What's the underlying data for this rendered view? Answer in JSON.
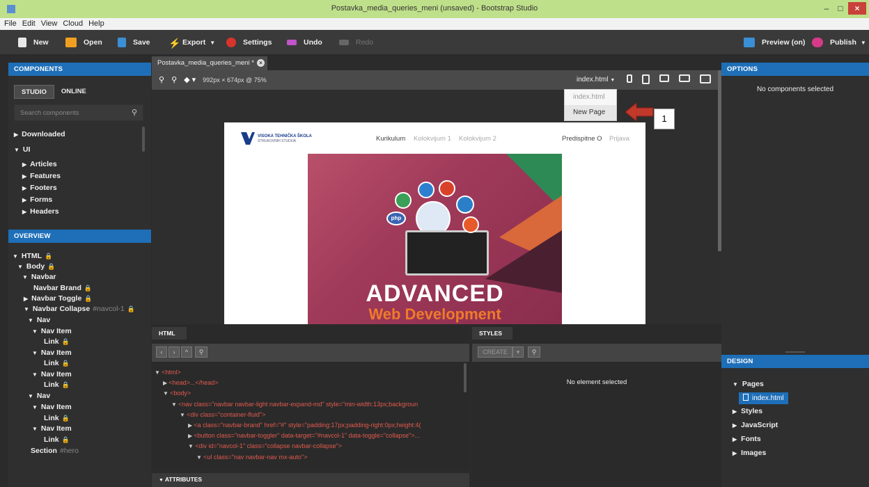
{
  "window": {
    "title": "Postavka_media_queries_meni (unsaved) - Bootstrap Studio",
    "min": "–",
    "max": "□",
    "close": "×"
  },
  "menu": [
    "File",
    "Edit",
    "View",
    "Cloud",
    "Help"
  ],
  "toolbar": {
    "new": "New",
    "open": "Open",
    "save": "Save",
    "export": "Export",
    "settings": "Settings",
    "undo": "Undo",
    "redo": "Redo",
    "preview": "Preview (on)",
    "publish": "Publish"
  },
  "colors": {
    "accent": "#1e6fb8",
    "code_tag": "#e05a4e",
    "callout_arrow": "#c0392b"
  },
  "components": {
    "header": "COMPONENTS",
    "tabs": [
      "STUDIO",
      "ONLINE"
    ],
    "search_placeholder": "Search components",
    "items": [
      {
        "label": "Downloaded",
        "expanded": false
      },
      {
        "label": "UI",
        "expanded": true
      },
      {
        "label": "Articles",
        "expanded": false
      },
      {
        "label": "Features",
        "expanded": false
      },
      {
        "label": "Footers",
        "expanded": false
      },
      {
        "label": "Forms",
        "expanded": false
      },
      {
        "label": "Headers",
        "expanded": false
      }
    ]
  },
  "overview": {
    "header": "OVERVIEW",
    "items": [
      {
        "label": "HTML"
      },
      {
        "label": "Body"
      },
      {
        "label": "Navbar"
      },
      {
        "label": "Navbar Brand"
      },
      {
        "label": "Navbar Toggle"
      },
      {
        "label": "Navbar Collapse",
        "hint": "#navcol-1"
      },
      {
        "label": "Nav"
      },
      {
        "label": "Nav Item"
      },
      {
        "label": "Link"
      },
      {
        "label": "Nav Item"
      },
      {
        "label": "Link"
      },
      {
        "label": "Nav Item"
      },
      {
        "label": "Link"
      },
      {
        "label": "Nav"
      },
      {
        "label": "Nav Item"
      },
      {
        "label": "Link"
      },
      {
        "label": "Nav Item"
      },
      {
        "label": "Link"
      },
      {
        "label": "Section",
        "hint": "#hero"
      }
    ]
  },
  "editor": {
    "tab_label": "Postavka_media_queries_meni *",
    "size_readout": "992px × 674px @ 75%",
    "page_select": "index.html",
    "dropdown": [
      "index.html",
      "New Page"
    ],
    "callout": "1"
  },
  "preview_page": {
    "brand_line1": "VISOKA TEHNIČKA ŠKOLA",
    "brand_line2": "STRUKOVNIH STUDIJA",
    "nav": [
      "Kurikulum",
      "Kolokvijum 1",
      "Kolokvijum 2"
    ],
    "nav_right": [
      "Predispitne O",
      "Prijava"
    ],
    "hero_title": "ADVANCED",
    "hero_sub": "Web Development",
    "badges": [
      "php"
    ]
  },
  "html_panel": {
    "header": "HTML",
    "attributes_header": "ATTRIBUTES",
    "lines": [
      "<html>",
      "<head>...</head>",
      "<body>",
      "<nav class=\"navbar navbar-light navbar-expand-md\" style=\"min-width:13px;backgroun",
      "<div class=\"container-fluid\">",
      "<a class=\"navbar-brand\" href=\"#\" style=\"padding:17px;padding-right:0px;height:4(",
      "<button class=\"navbar-toggler\" data-target=\"#navcol-1\" data-toggle=\"collapse\">...",
      "<div id=\"navcol-1\" class=\"collapse navbar-collapse\">",
      "<ul class=\"nav navbar-nav mx-auto\">"
    ]
  },
  "styles_panel": {
    "header": "STYLES",
    "create": "CREATE",
    "empty": "No element selected"
  },
  "options": {
    "header": "OPTIONS",
    "empty": "No components selected"
  },
  "design": {
    "header": "DESIGN",
    "items": [
      "Pages",
      "index.html",
      "Styles",
      "JavaScript",
      "Fonts",
      "Images"
    ]
  }
}
